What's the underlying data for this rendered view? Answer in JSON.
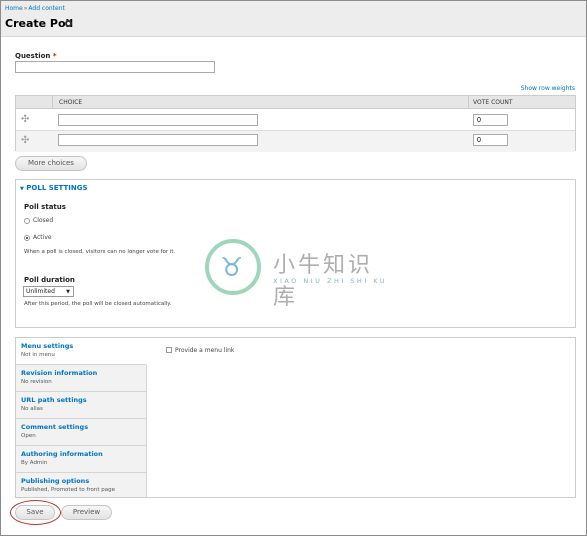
{
  "breadcrumb": {
    "home": "Home",
    "separator": "»",
    "current": "Add content"
  },
  "page_title": "Create Poll",
  "question": {
    "label": "Question",
    "required_marker": "*",
    "value": ""
  },
  "show_row_weights": "Show row weights",
  "choices_table": {
    "headers": [
      "CHOICE",
      "VOTE COUNT"
    ],
    "rows": [
      {
        "choice": "",
        "vote_count": "0"
      },
      {
        "choice": "",
        "vote_count": "0"
      }
    ]
  },
  "more_choices_button": "More choices",
  "poll_settings": {
    "legend": "POLL SETTINGS",
    "status_label": "Poll status",
    "options": [
      "Closed",
      "Active"
    ],
    "selected": "Active",
    "status_help": "When a poll is closed, visitors can no longer vote for it.",
    "duration_label": "Poll duration",
    "duration_value": "Unlimited",
    "duration_help": "After this period, the poll will be closed automatically."
  },
  "vertical_tabs": [
    {
      "title": "Menu settings",
      "summary": "Not in menu"
    },
    {
      "title": "Revision information",
      "summary": "No revision"
    },
    {
      "title": "URL path settings",
      "summary": "No alias"
    },
    {
      "title": "Comment settings",
      "summary": "Open"
    },
    {
      "title": "Authoring information",
      "summary": "By Admin"
    },
    {
      "title": "Publishing options",
      "summary": "Published, Promoted to front page"
    }
  ],
  "menu_link_checkbox": "Provide a menu link",
  "actions": {
    "save": "Save",
    "preview": "Preview"
  },
  "watermark": {
    "text": "小牛知识库",
    "sub": "XIAO NIU ZHI SHI KU"
  },
  "colors": {
    "link": "#0074bd",
    "highlight_circle": "#c0302f"
  }
}
